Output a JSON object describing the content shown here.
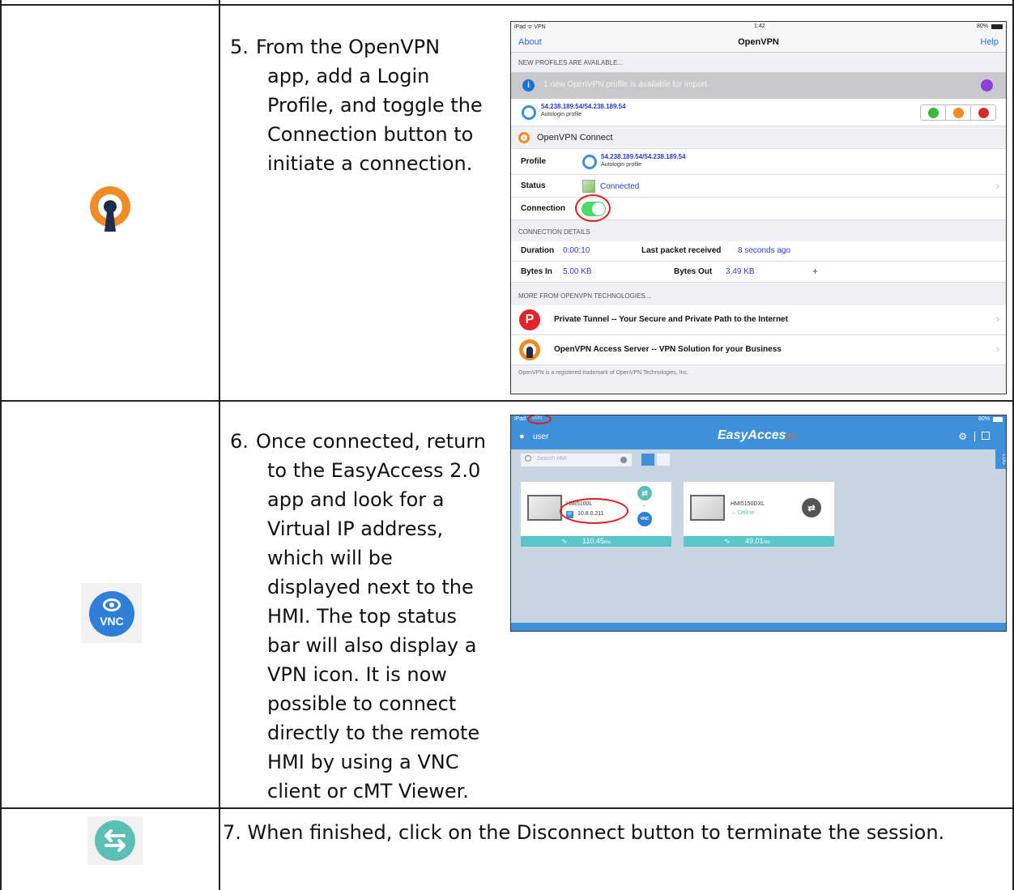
{
  "steps": [
    {
      "number": "5.",
      "lines": [
        "From the OpenVPN",
        "app, add a Login",
        "Profile, and toggle the",
        "Connection button to",
        "initiate a connection."
      ],
      "icon": "openvpn-logo-icon"
    },
    {
      "number": "6.",
      "lines": [
        "Once connected, return",
        "to the EasyAccess 2.0",
        "app and look for a",
        "Virtual IP address,",
        "which will be",
        "displayed next to the",
        "HMI. The top status",
        "bar will also display a",
        "VPN icon. It is now",
        "possible to connect",
        "directly to the remote",
        "HMI by using a VNC",
        "client or cMT Viewer."
      ],
      "icon": "vnc-icon",
      "icon_text": "VNC"
    },
    {
      "text": "7. When finished, click on the Disconnect button to terminate the session.",
      "icon": "disconnect-arrows-icon"
    }
  ],
  "openvpn": {
    "status_left": "iPad ᯤ VPN",
    "status_time": "1:42",
    "status_right": "80%",
    "nav_left": "About",
    "nav_title": "OpenVPN",
    "nav_right": "Help",
    "new_profiles_header": "NEW PROFILES ARE AVAILABLE...",
    "import_text": "1 new OpenVPN profile is available for import.",
    "import_profile": "54.238.189.54/54.238.189.54",
    "import_profile_sub": "Autologin profile",
    "connect_header": "OpenVPN Connect",
    "profile_label": "Profile",
    "profile_value": "54.238.189.54/54.238.189.54",
    "profile_sub": "Autologin profile",
    "status_label": "Status",
    "status_value": "Connected",
    "connection_label": "Connection",
    "details_header": "CONNECTION DETAILS",
    "duration_label": "Duration",
    "duration_value": "0:00:10",
    "last_packet_label": "Last packet received",
    "last_packet_value": "8 seconds ago",
    "bytes_in_label": "Bytes In",
    "bytes_in_value": "5.00 KB",
    "bytes_out_label": "Bytes Out",
    "bytes_out_value": "3.49 KB",
    "plus": "+",
    "more_header": "MORE FROM OPENVPN TECHNOLOGIES...",
    "private_tunnel": "Private Tunnel -- Your Secure and Private Path to the Internet",
    "access_server": "OpenVPN Access Server -- VPN Solution for your Business",
    "footer": "OpenVPN is a registered trademark of OpenVPN Technologies, Inc.",
    "chevron": "›"
  },
  "easyaccess": {
    "status_left": "iPad",
    "status_vpn": "VPN",
    "status_right": "80%",
    "user": "user",
    "title": "EasyAcces",
    "title_suffix": "2.0",
    "search_placeholder": "Search HMI",
    "log_tab": "LOG",
    "hmi1_name": "HMI5100L",
    "hmi1_ip_badge": "IP",
    "hmi1_ip": "10.8.0.211",
    "hmi1_latency": "110.45",
    "hmi1_latency_unit": "ms",
    "hmi1_vnc": "VNC",
    "hmi2_name": "HMI5150DXL",
    "hmi2_status": "Online",
    "hmi2_latency": "49.01",
    "hmi2_latency_unit": "ms"
  },
  "colors": {
    "openvpn_orange": "#f08a24",
    "openvpn_navy": "#1f2d4d",
    "vnc_blue": "#2f7fd8",
    "disconnect_teal": "#5bbfb8",
    "toggle_green": "#4cd964",
    "easyaccess_blue": "#3e90d8",
    "annotation_red": "#e01b1b"
  }
}
